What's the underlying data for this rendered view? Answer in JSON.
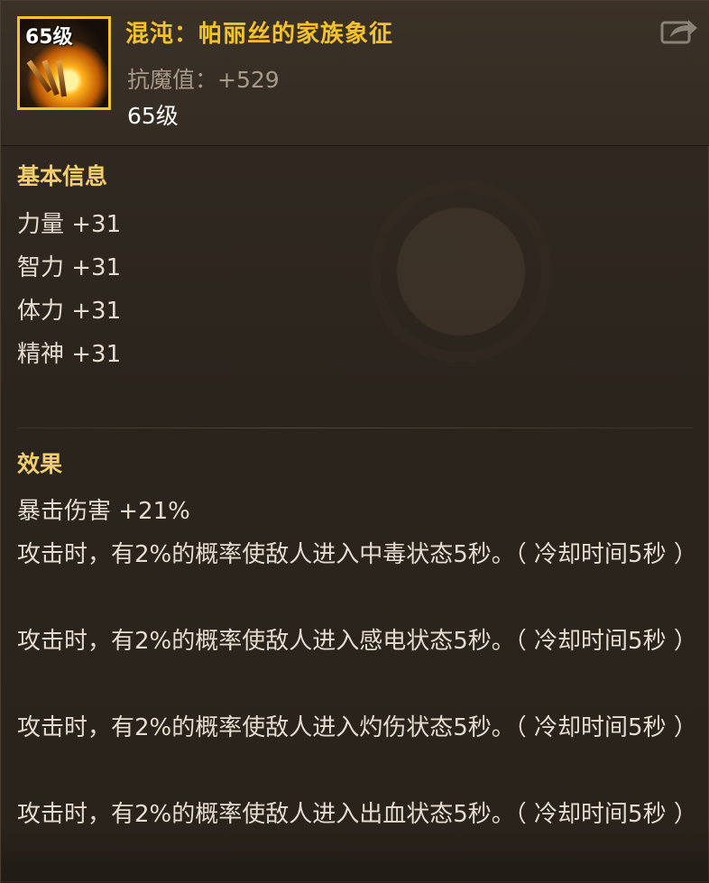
{
  "item": {
    "icon_level": "65级",
    "name": "混沌：帕丽丝的家族象征",
    "stat": "抗魔值：+529",
    "level": "65级",
    "share_icon": "share-export-icon"
  },
  "basic": {
    "title": "基本信息",
    "lines": [
      "力量 +31",
      "智力 +31",
      "体力 +31",
      "精神 +31"
    ]
  },
  "effects": {
    "title": "效果",
    "lines": [
      "暴击伤害 +21%",
      "攻击时，有2%的概率使敌人进入中毒状态5秒。（ 冷却时间5秒 ）",
      "攻击时，有2%的概率使敌人进入感电状态5秒。（ 冷却时间5秒 ）",
      "攻击时，有2%的概率使敌人进入灼伤状态5秒。（ 冷却时间5秒 ）",
      "攻击时，有2%的概率使敌人进入出血状态5秒。（ 冷却时间5秒 ）"
    ]
  },
  "colors": {
    "title": "#f5c22b",
    "section": "#f3cf6b",
    "body_text": "#e6dccf",
    "stat_text": "#a89a88",
    "icon_border": "#f2c230"
  }
}
